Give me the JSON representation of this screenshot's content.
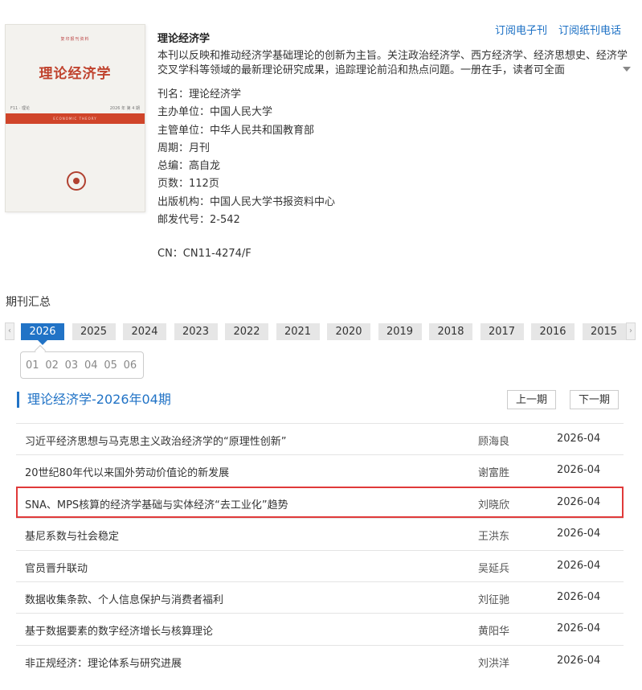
{
  "journal": {
    "name": "理论经济学",
    "description": "本刊以反映和推动经济学基础理论的创新为主旨。关注政治经济学、西方经济学、经济思想史、经济学交叉学科等领域的最新理论研究成果，追踪理论前沿和热点问题。一册在手，读者可全面",
    "meta": [
      "刊名：理论经济学",
      "主办单位：中国人民大学",
      "主管单位：中华人民共和国教育部",
      "周期：月刊",
      "总编：高自龙",
      "页数：112页",
      "出版机构：中国人民大学书报资料中心",
      "邮发代号：2-542"
    ],
    "cn": "CN：CN11-4274/F"
  },
  "cover": {
    "title": "理论经济学",
    "series": "复印报刊资料",
    "issue_left": "F11 · 理论",
    "issue_right": "2026 年 第 4 期",
    "band_text": "ECONOMIC THEORY"
  },
  "subscribe": {
    "electronic": "订阅电子刊",
    "paper": "订阅纸刊电话"
  },
  "archive": {
    "title": "期刊汇总",
    "left_arrow": "‹",
    "right_arrow": "›",
    "years": [
      "2026",
      "2025",
      "2024",
      "2023",
      "2022",
      "2021",
      "2020",
      "2019",
      "2018",
      "2017",
      "2016",
      "2015"
    ],
    "active_year": "2026",
    "issues": [
      "01",
      "02",
      "03",
      "04",
      "05",
      "06"
    ]
  },
  "issue": {
    "title": "理论经济学-2026年04期",
    "prev": "上一期",
    "next": "下一期"
  },
  "articles": [
    {
      "title": "习近平经济思想与马克思主义政治经济学的“原理性创新”",
      "author": "顾海良",
      "date": "2026-04"
    },
    {
      "title": "20世纪80年代以来国外劳动价值论的新发展",
      "author": "谢富胜",
      "date": "2026-04"
    },
    {
      "title": "SNA、MPS核算的经济学基础与实体经济“去工业化”趋势",
      "author": "刘晓欣",
      "date": "2026-04"
    },
    {
      "title": "基尼系数与社会稳定",
      "author": "王洪东",
      "date": "2026-04"
    },
    {
      "title": "官员晋升联动",
      "author": "吴延兵",
      "date": "2026-04"
    },
    {
      "title": "数据收集条款、个人信息保护与消费者福利",
      "author": "刘征驰",
      "date": "2026-04"
    },
    {
      "title": "基于数据要素的数字经济增长与核算理论",
      "author": "黄阳华",
      "date": "2026-04"
    },
    {
      "title": "非正规经济：理论体系与研究进展",
      "author": "刘洪洋",
      "date": "2026-04"
    }
  ],
  "colors": {
    "accent": "#2173c6",
    "link": "#1a6fc4",
    "highlight": "#e03a3a",
    "cover_red": "#d0452a"
  }
}
